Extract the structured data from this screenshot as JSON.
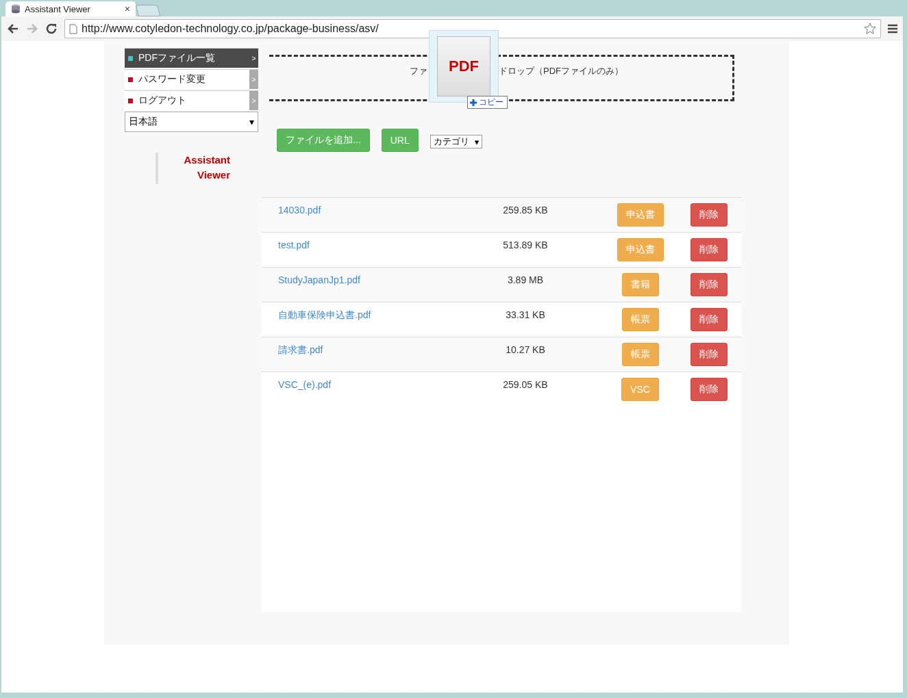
{
  "browser": {
    "tab_title": "Assistant Viewer",
    "tab_close": "×",
    "url": "http://www.cotyledon-technology.co.jp/package-business/asv/"
  },
  "sidebar": {
    "items": [
      {
        "label": "PDFファイル一覧",
        "selected": true,
        "chevron": ">"
      },
      {
        "label": "パスワード変更",
        "selected": false,
        "chevron": ">"
      },
      {
        "label": "ログアウト",
        "selected": false,
        "chevron": ">"
      }
    ],
    "language": "日本語",
    "language_arrow": "▾",
    "logo": [
      "Assistant",
      "Viewer"
    ]
  },
  "dropzone": {
    "text_left": "ファ",
    "text_right": "ドロップ（PDFファイルのみ）",
    "drag_icon_label": "PDF",
    "copy_label": "コピー"
  },
  "toolbar": {
    "add_button": "ファイルを追加...",
    "url_button": "URL",
    "category_select": "カテゴリ",
    "category_arrow": "▾"
  },
  "files": [
    {
      "name": "14030.pdf",
      "size": "259.85 KB",
      "category": "申込書",
      "delete": "削除"
    },
    {
      "name": "test.pdf",
      "size": "513.89 KB",
      "category": "申込書",
      "delete": "削除"
    },
    {
      "name": "StudyJapanJp1.pdf",
      "size": "3.89 MB",
      "category": "書籍",
      "delete": "削除"
    },
    {
      "name": "自動車保険申込書.pdf",
      "size": "33.31 KB",
      "category": "帳票",
      "delete": "削除"
    },
    {
      "name": "請求書.pdf",
      "size": "10.27 KB",
      "category": "帳票",
      "delete": "削除"
    },
    {
      "name": "VSC_(e).pdf",
      "size": "259.05 KB",
      "category": "VSC",
      "delete": "削除"
    }
  ]
}
